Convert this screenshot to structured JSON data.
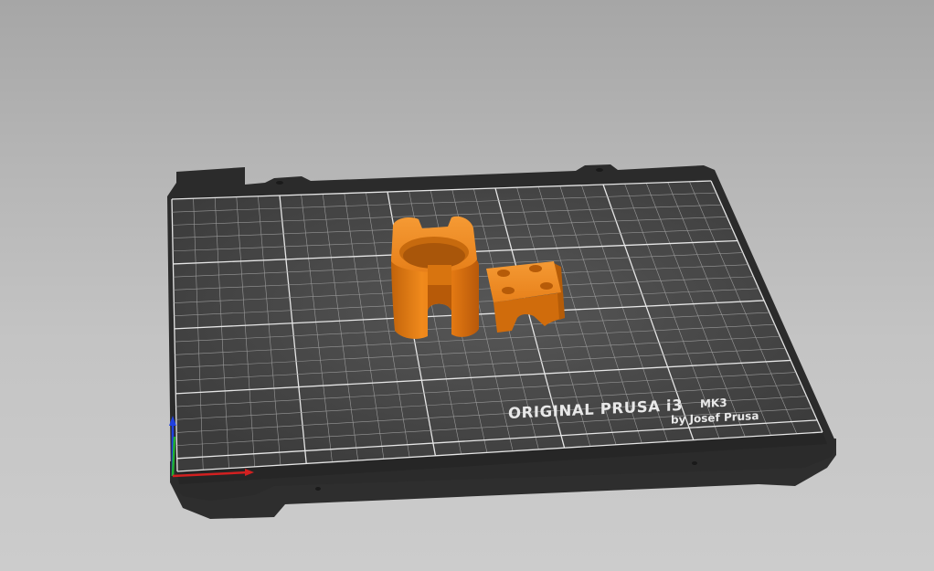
{
  "viewport": {
    "label": "3D plater view"
  },
  "bed": {
    "brand_line": "ORIGINAL PRUSA i3",
    "model": "MK3",
    "byline": "by Josef Prusa"
  },
  "objects": [
    {
      "name": "Cylindrical clip",
      "color": "#e07a12"
    },
    {
      "name": "Block with four holes",
      "color": "#e07a12"
    }
  ],
  "axes": {
    "x_color": "#d22020",
    "y_color": "#1fb030",
    "z_color": "#2040e0"
  }
}
